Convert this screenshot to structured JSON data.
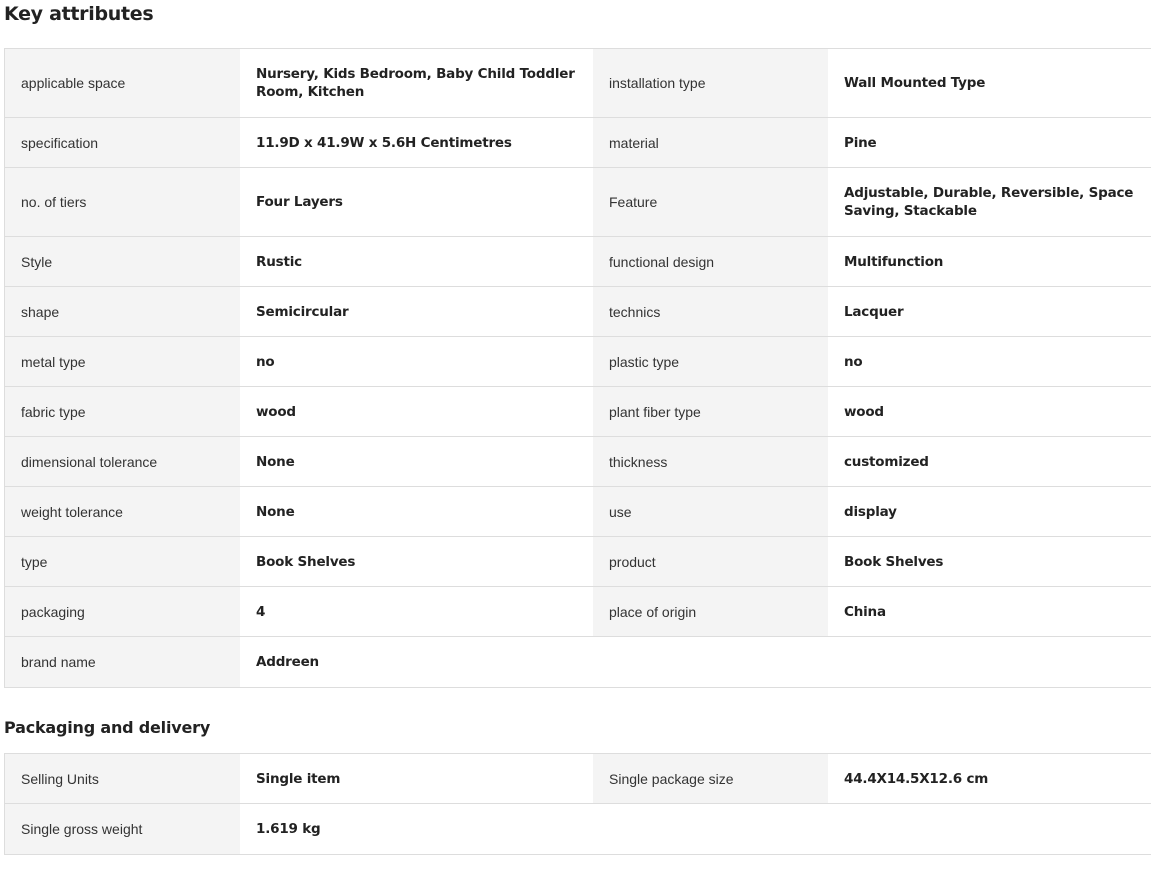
{
  "key_attributes": {
    "title": "Key attributes",
    "rows": [
      {
        "l1": "applicable space",
        "v1": "Nursery, Kids Bedroom, Baby Child Toddler Room, Kitchen",
        "l2": "installation type",
        "v2": "Wall Mounted Type"
      },
      {
        "l1": "specification",
        "v1": "11.9D x 41.9W x 5.6H Centimetres",
        "l2": "material",
        "v2": "Pine"
      },
      {
        "l1": "no. of tiers",
        "v1": "Four Layers",
        "l2": "Feature",
        "v2": "Adjustable, Durable, Reversible, Space Saving, Stackable"
      },
      {
        "l1": "Style",
        "v1": "Rustic",
        "l2": "functional design",
        "v2": "Multifunction"
      },
      {
        "l1": "shape",
        "v1": "Semicircular",
        "l2": "technics",
        "v2": "Lacquer"
      },
      {
        "l1": "metal type",
        "v1": "no",
        "l2": "plastic type",
        "v2": "no"
      },
      {
        "l1": "fabric type",
        "v1": "wood",
        "l2": "plant fiber type",
        "v2": "wood"
      },
      {
        "l1": "dimensional tolerance",
        "v1": "None",
        "l2": "thickness",
        "v2": "customized"
      },
      {
        "l1": "weight tolerance",
        "v1": "None",
        "l2": "use",
        "v2": "display"
      },
      {
        "l1": "type",
        "v1": "Book Shelves",
        "l2": "product",
        "v2": "Book Shelves"
      },
      {
        "l1": "packaging",
        "v1": "4",
        "l2": "place of origin",
        "v2": "China"
      },
      {
        "l1": "brand name",
        "v1": "Addreen",
        "l2": "",
        "v2": ""
      }
    ]
  },
  "packaging_delivery": {
    "title": "Packaging and delivery",
    "rows": [
      {
        "l1": "Selling Units",
        "v1": "Single item",
        "l2": "Single package size",
        "v2": "44.4X14.5X12.6 cm"
      },
      {
        "l1": "Single gross weight",
        "v1": "1.619 kg",
        "l2": "",
        "v2": ""
      }
    ]
  }
}
